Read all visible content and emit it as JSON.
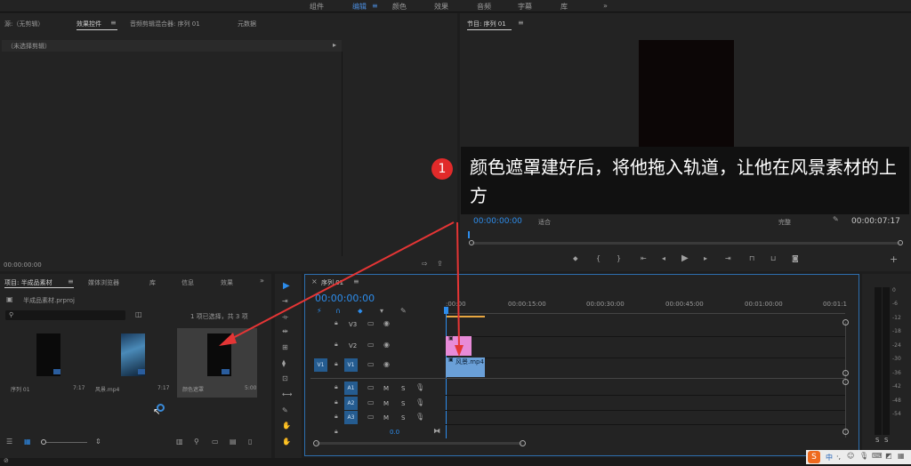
{
  "workspace_tabs": {
    "assembly": "组件",
    "editing": "编辑",
    "color": "颜色",
    "effects": "效果",
    "audio": "音频",
    "captions": "字幕",
    "library": "库",
    "more": "»"
  },
  "source_panel": {
    "tab_source": "源:（无剪辑）",
    "tab_effect_controls": "效果控件",
    "tab_audio_mixer": "音频剪辑混合器: 序列 01",
    "tab_metadata": "元数据",
    "no_clip": "（未选择剪辑）",
    "timecode": "00:00:00:00"
  },
  "program_monitor": {
    "title": "节目: 序列 01",
    "timecode": "00:00:00:00",
    "fit": "适合",
    "quality": "完整",
    "duration": "00:00:07:17"
  },
  "annotation": {
    "number": "1",
    "text": "颜色遮罩建好后，将他拖入轨道，让他在风景素材的上方"
  },
  "project_panel": {
    "tab_project": "项目: 半成品素材",
    "tab_media_browser": "媒体浏览器",
    "tab_library": "库",
    "tab_info": "信息",
    "tab_effects": "效果",
    "file": "半成品素材.prproj",
    "selection_info": "1 项已选择，共 3 项",
    "items": [
      {
        "name": "序列 01",
        "duration": "7:17"
      },
      {
        "name": "风景.mp4",
        "duration": "7:17"
      },
      {
        "name": "颜色遮罩",
        "duration": "5:00"
      }
    ]
  },
  "timeline": {
    "title": "序列 01",
    "timecode": "00:00:00:00",
    "ruler": [
      ":00:00",
      "00:00:15:00",
      "00:00:30:00",
      "00:00:45:00",
      "00:01:00:00",
      "00:01:1"
    ],
    "video_tracks": [
      {
        "name": "V3",
        "src": ""
      },
      {
        "name": "V2",
        "src": ""
      },
      {
        "name": "V1",
        "src": "V1"
      }
    ],
    "audio_tracks": [
      {
        "name": "A1",
        "m": "M",
        "s": "S"
      },
      {
        "name": "A2",
        "m": "M",
        "s": "S"
      },
      {
        "name": "A3",
        "m": "M",
        "s": "S"
      }
    ],
    "master_value": "0.0",
    "clip_v1_label": "风景.mp4",
    "colors": {
      "v2_clip": "#e88bd8",
      "v1_clip": "#6aa0d8",
      "accent": "#2d8ceb"
    }
  },
  "audio_meter": {
    "labels": [
      "0",
      "-6",
      "-12",
      "-18",
      "-24",
      "-30",
      "-36",
      "-42",
      "-48",
      "-54"
    ],
    "solo_left": "S",
    "solo_right": "S"
  },
  "taskbar": {
    "ime": "中",
    "ime_extra": "·,"
  }
}
